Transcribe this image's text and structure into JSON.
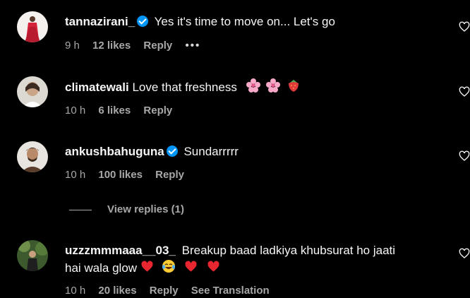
{
  "comments": [
    {
      "username": "tannazirani_",
      "verified": true,
      "text": "Yes it's time to move on... Let's go",
      "time": "9 h",
      "likes": "12 likes",
      "reply": "Reply",
      "more": "•••"
    },
    {
      "username": "climatewali",
      "verified": false,
      "text": "Love that freshness",
      "emojis": [
        "cherry-blossom",
        "cherry-blossom",
        "strawberry"
      ],
      "time": "10 h",
      "likes": "6 likes",
      "reply": "Reply"
    },
    {
      "username": "ankushbahuguna",
      "verified": true,
      "text": "Sundarrrrr",
      "time": "10 h",
      "likes": "100 likes",
      "reply": "Reply",
      "view_replies": "View replies (1)"
    },
    {
      "username": "uzzzmmmaaa__03_",
      "verified": false,
      "text_line1": "Breakup baad ladkiya khubsurat ho jaati",
      "text_line2": "hai wala glow",
      "emojis": [
        "red-heart",
        "tears-of-joy",
        "red-heart",
        "red-heart"
      ],
      "time": "10 h",
      "likes": "20 likes",
      "reply": "Reply",
      "see_translation": "See Translation"
    }
  ],
  "colors": {
    "background": "#000000",
    "text": "#f5f5f5",
    "muted": "#a8a8a8",
    "verified": "#0095f6"
  },
  "icons": [
    "verified-badge-icon",
    "heart-icon",
    "more-options-icon"
  ]
}
